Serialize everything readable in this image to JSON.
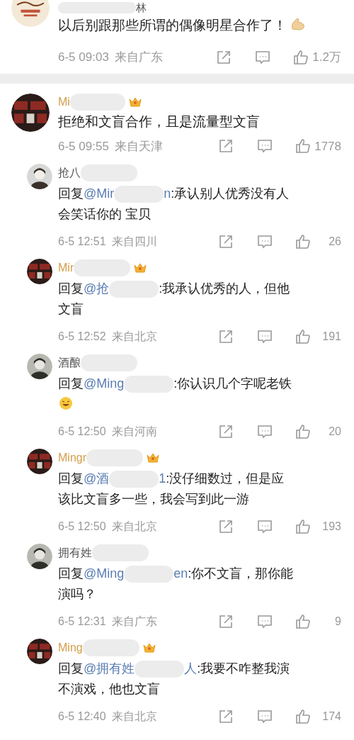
{
  "top_comment": {
    "author": "林",
    "text": "以后别跟那些所谓的偶像明星合作了！",
    "emoji": true,
    "time": "6-5 09:03",
    "location": "来自广东",
    "likes": "1.2万"
  },
  "comment": {
    "author": "Mi",
    "vip": true,
    "text": "拒绝和文盲合作，且是流量型文盲",
    "time": "6-5 09:55",
    "location": "来自天津",
    "likes": "1778",
    "replies": [
      {
        "author": "抢八",
        "vip": false,
        "prefix": "回复",
        "mention_start": "@Mir",
        "mention_end": "n",
        "text": ":承认别人优秀没有人会笑话你的 宝贝",
        "emoji": false,
        "time": "6-5 12:51",
        "location": "来自四川",
        "likes": "26"
      },
      {
        "author": "Mir",
        "vip": true,
        "prefix": "回复",
        "mention_start": "@抢",
        "text": ":我承认优秀的人，但他文盲",
        "emoji": false,
        "time": "6-5 12:52",
        "location": "来自北京",
        "likes": "191"
      },
      {
        "author": "酒酿",
        "vip": false,
        "prefix": "回复",
        "mention_start": "@Ming",
        "text": ":你认识几个字呢老铁",
        "emoji": true,
        "time": "6-5 12:50",
        "location": "来自河南",
        "likes": "20"
      },
      {
        "author": "Mingr",
        "vip": true,
        "prefix": "回复",
        "mention_start": "@酒",
        "mention_end": "1",
        "text": ":没仔细数过，但是应该比文盲多一些，我会写到此一游",
        "emoji": false,
        "time": "6-5 12:50",
        "location": "来自北京",
        "likes": "193"
      },
      {
        "author": "拥有姓",
        "vip": false,
        "prefix": "回复",
        "mention_start": "@Ming",
        "mention_end": "en",
        "text": ":你不文盲，那你能演吗？",
        "emoji": false,
        "time": "6-5 12:31",
        "location": "来自广东",
        "likes": "9"
      },
      {
        "author": "Ming",
        "vip": true,
        "prefix": "回复",
        "mention_start": "@拥有姓",
        "mention_end": "人",
        "text": ":我要不咋整我演不演戏，他也文盲",
        "emoji": false,
        "time": "6-5 12:40",
        "location": "来自北京",
        "likes": "174"
      }
    ]
  }
}
